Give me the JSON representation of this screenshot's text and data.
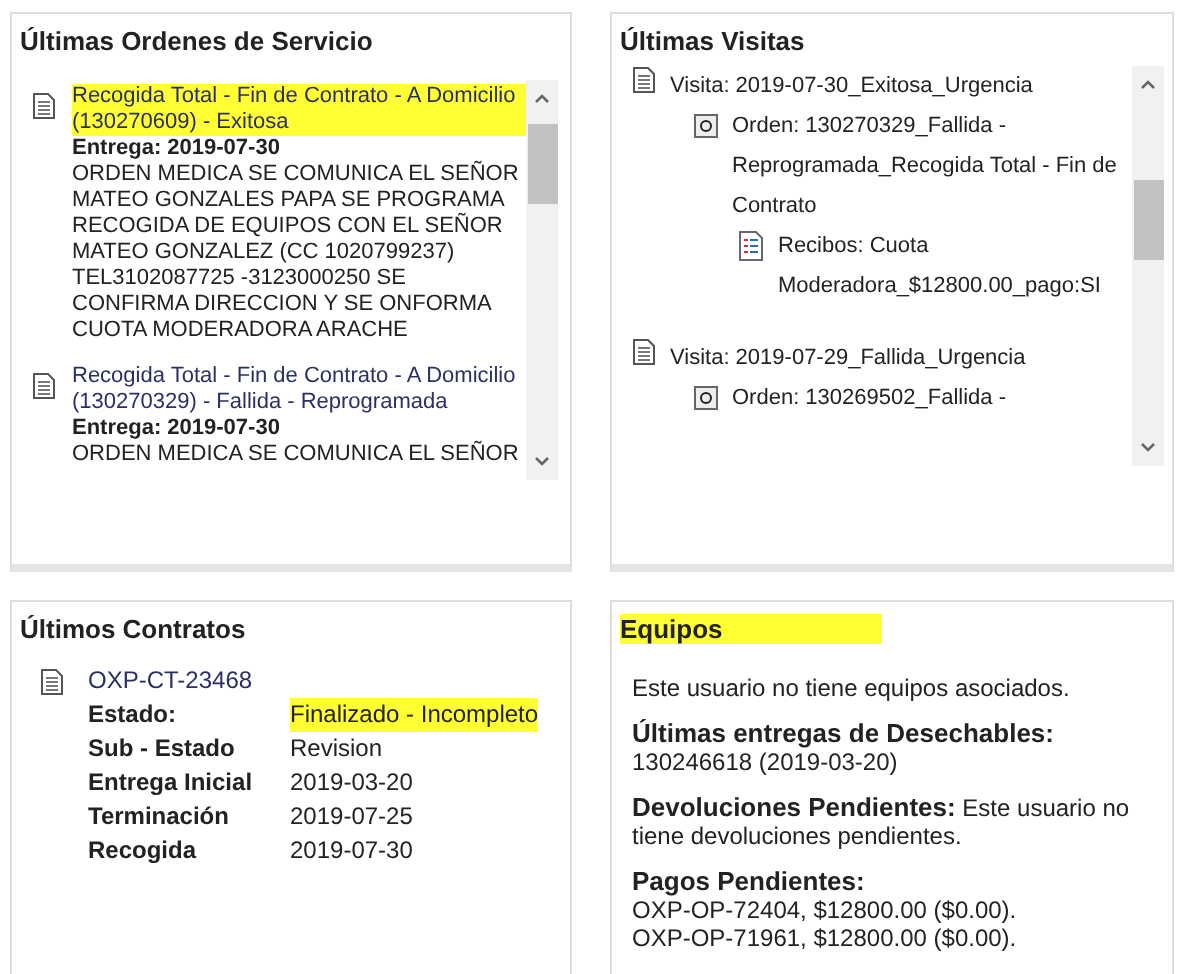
{
  "orders_panel": {
    "title": "Últimas Ordenes de Servicio",
    "orders": [
      {
        "title": "Recogida Total - Fin de Contrato - A Domicilio (130270609) - Exitosa",
        "highlighted": true,
        "delivery": "Entrega: 2019-07-30",
        "description": "ORDEN MEDICA SE COMUNICA EL SEÑOR MATEO GONZALES PAPA SE PROGRAMA RECOGIDA DE EQUIPOS CON EL SEÑOR MATEO GONZALEZ (CC 1020799237) TEL3102087725 -3123000250 SE CONFIRMA DIRECCION Y SE ONFORMA CUOTA MODERADORA ARACHE"
      },
      {
        "title": "Recogida Total - Fin de Contrato - A Domicilio (130270329) - Fallida - Reprogramada",
        "highlighted": false,
        "delivery": "Entrega: 2019-07-30",
        "description": "ORDEN MEDICA SE COMUNICA EL SEÑOR"
      }
    ]
  },
  "visits_panel": {
    "title": "Últimas Visitas",
    "visits": [
      {
        "label": "Visita: 2019-07-30_Exitosa_Urgencia",
        "children": [
          {
            "label": "Orden: 130270329_Fallida - Reprogramada_Recogida Total - Fin de Contrato",
            "children": [
              {
                "label": "Recibos: Cuota Moderadora_$12800.00_pago:SI"
              }
            ]
          }
        ]
      },
      {
        "label": "Visita: 2019-07-29_Fallida_Urgencia",
        "children": [
          {
            "label": "Orden: 130269502_Fallida -"
          }
        ]
      }
    ]
  },
  "contracts_panel": {
    "title": "Últimos Contratos",
    "code": "OXP-CT-23468",
    "fields": [
      {
        "label": "Estado:",
        "value": "Finalizado - Incompleto",
        "highlighted": true
      },
      {
        "label": "Sub - Estado",
        "value": "Revision",
        "highlighted": false
      },
      {
        "label": "Entrega Inicial",
        "value": "2019-03-20",
        "highlighted": false
      },
      {
        "label": "Terminación",
        "value": "2019-07-25",
        "highlighted": false
      },
      {
        "label": "Recogida",
        "value": "2019-07-30",
        "highlighted": false
      }
    ]
  },
  "equipment_panel": {
    "title": "Equipos",
    "highlighted": true,
    "no_equipment": "Este usuario no tiene equipos asociados.",
    "disposables_label": "Últimas entregas de Desechables:",
    "disposables": "130246618 (2019-03-20)",
    "returns_label": "Devoluciones Pendientes:",
    "returns_text": "Este usuario no tiene devoluciones pendientes.",
    "payments_label": "Pagos Pendientes:",
    "payments": [
      "OXP-OP-72404, $12800.00 ($0.00).",
      "OXP-OP-71961, $12800.00 ($0.00)."
    ]
  }
}
